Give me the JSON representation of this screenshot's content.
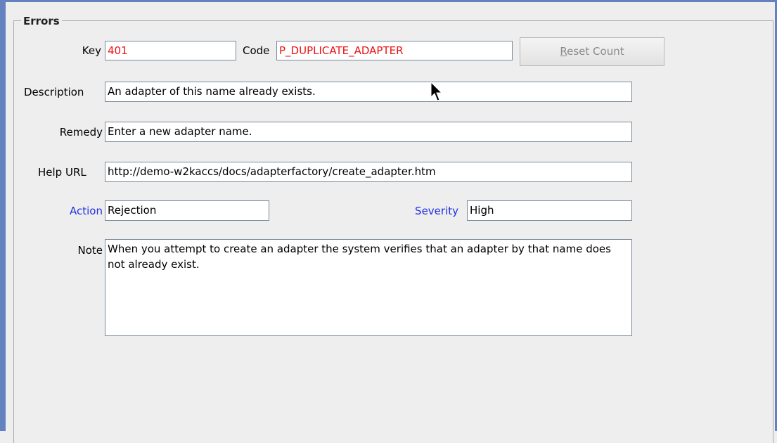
{
  "group": {
    "title": "Errors"
  },
  "fields": {
    "key": {
      "label": "Key",
      "value": "401"
    },
    "code": {
      "label": "Code",
      "value": "P_DUPLICATE_ADAPTER"
    },
    "description": {
      "label": "Description",
      "value": "An adapter of this name already exists."
    },
    "remedy": {
      "label": "Remedy",
      "value": "Enter a new adapter name."
    },
    "help_url": {
      "label": "Help URL",
      "value": "http://demo-w2kaccs/docs/adapterfactory/create_adapter.htm"
    },
    "action": {
      "label": "Action",
      "value": "Rejection"
    },
    "severity": {
      "label": "Severity",
      "value": "High"
    },
    "note": {
      "label": "Note",
      "value": "When you attempt to create an adapter the system verifies that an adapter by that name does not already exist."
    }
  },
  "buttons": {
    "reset_count": {
      "mnemonic": "R",
      "rest": "eset Count"
    }
  },
  "colors": {
    "error_text": "#ee1111",
    "link_label": "#1f2ee0",
    "window_border": "#6382bf"
  }
}
